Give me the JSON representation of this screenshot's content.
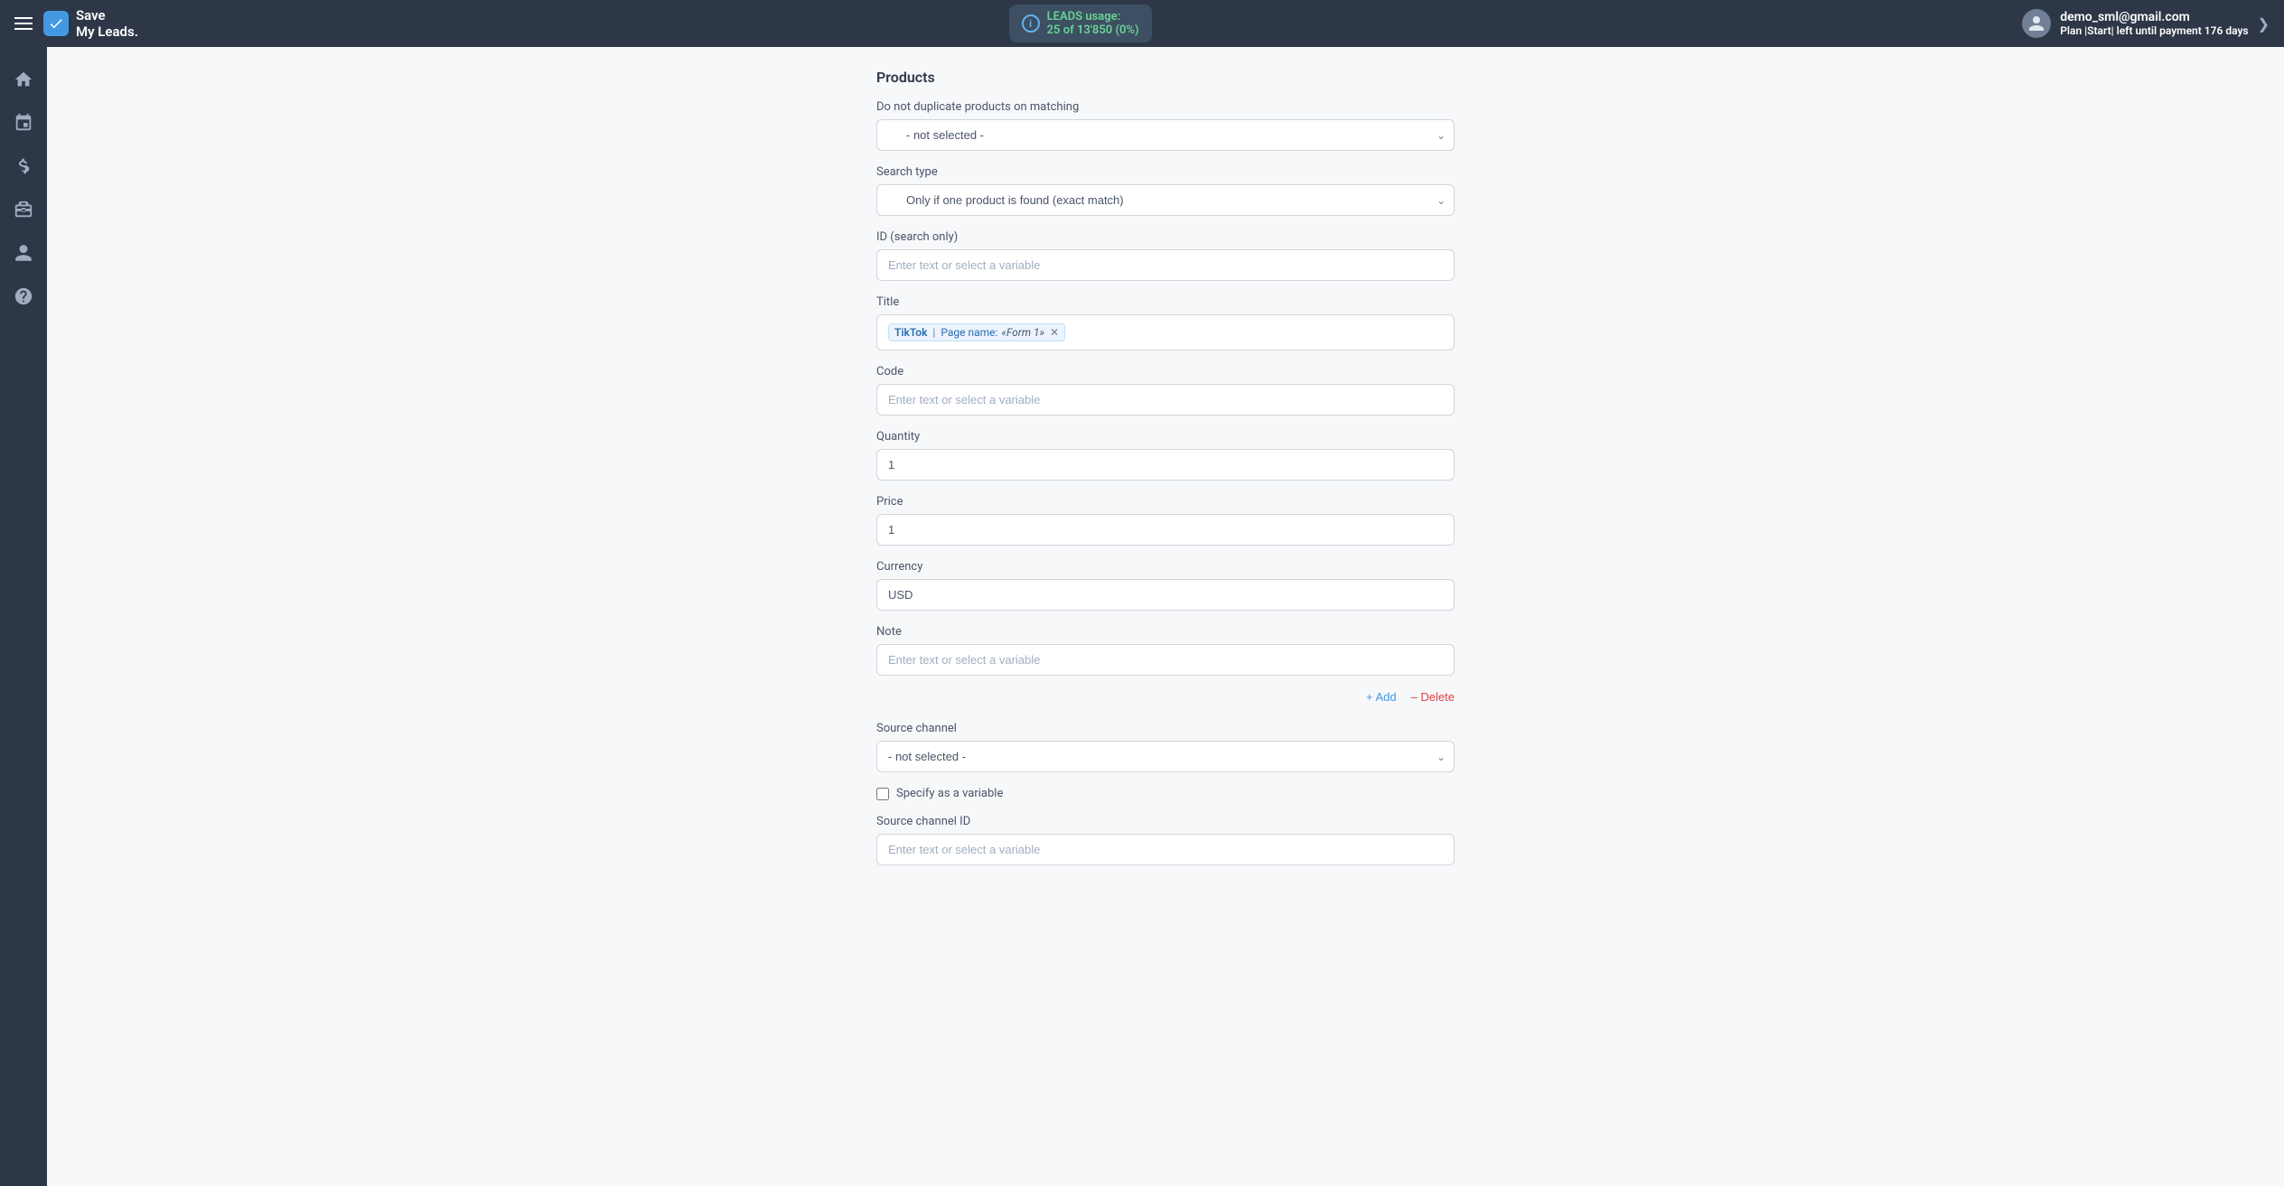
{
  "header": {
    "menu_icon": "☰",
    "logo_text_line1": "Save",
    "logo_text_line2": "My Leads.",
    "leads_label": "LEADS usage:",
    "leads_used": "25",
    "leads_separator": "of",
    "leads_total": "13'850",
    "leads_percent": "(0%)",
    "user_email": "demo_sml@gmail.com",
    "user_plan_label": "Plan |Start| left until payment",
    "user_plan_days": "176 days",
    "expand_icon": "❯"
  },
  "sidebar": {
    "items": [
      {
        "label": "home-icon",
        "icon": "home"
      },
      {
        "label": "connections-icon",
        "icon": "connections"
      },
      {
        "label": "billing-icon",
        "icon": "billing"
      },
      {
        "label": "briefcase-icon",
        "icon": "briefcase"
      },
      {
        "label": "user-icon",
        "icon": "user"
      },
      {
        "label": "help-icon",
        "icon": "help"
      }
    ]
  },
  "form": {
    "section_products": "Products",
    "field_no_duplicate": {
      "label": "Do not duplicate products on matching",
      "placeholder": "- not selected -",
      "options": [
        "- not selected -"
      ]
    },
    "field_search_type": {
      "label": "Search type",
      "value": "Only if one product is found (exact match)",
      "options": [
        "Only if one product is found (exact match)"
      ]
    },
    "field_id": {
      "label": "ID (search only)",
      "placeholder": "Enter text or select a variable"
    },
    "field_title": {
      "label": "Title",
      "tag": {
        "source": "TikTok",
        "separator": "|",
        "key": "Page name:",
        "value": "«Form 1»"
      }
    },
    "field_code": {
      "label": "Code",
      "placeholder": "Enter text or select a variable"
    },
    "field_quantity": {
      "label": "Quantity",
      "value": "1"
    },
    "field_price": {
      "label": "Price",
      "value": "1"
    },
    "field_currency": {
      "label": "Currency",
      "value": "USD"
    },
    "field_note": {
      "label": "Note",
      "placeholder": "Enter text or select a variable"
    },
    "btn_add": "+ Add",
    "btn_delete": "– Delete",
    "section_source": "Source channel",
    "field_source_channel": {
      "placeholder": "- not selected -",
      "options": [
        "- not selected -"
      ]
    },
    "checkbox_specify_variable": "Specify as a variable",
    "field_source_channel_id": {
      "label": "Source channel ID"
    }
  }
}
